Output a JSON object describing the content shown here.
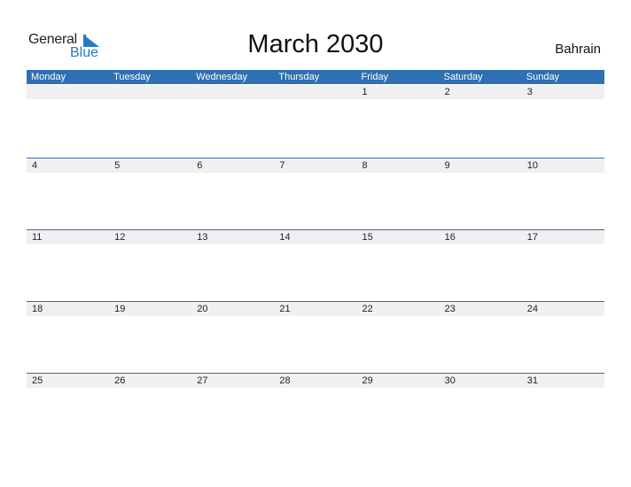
{
  "logo": {
    "general": "General",
    "blue": "Blue"
  },
  "title": "March 2030",
  "country": "Bahrain",
  "weekdays": [
    "Monday",
    "Tuesday",
    "Wednesday",
    "Thursday",
    "Friday",
    "Saturday",
    "Sunday"
  ],
  "weeks": [
    [
      "",
      "",
      "",
      "",
      "1",
      "2",
      "3"
    ],
    [
      "4",
      "5",
      "6",
      "7",
      "8",
      "9",
      "10"
    ],
    [
      "11",
      "12",
      "13",
      "14",
      "15",
      "16",
      "17"
    ],
    [
      "18",
      "19",
      "20",
      "21",
      "22",
      "23",
      "24"
    ],
    [
      "25",
      "26",
      "27",
      "28",
      "29",
      "30",
      "31"
    ]
  ],
  "colors": {
    "accent": "#2e70b2",
    "brand_blue": "#2b78c6",
    "row_bg": "#f0f0f0"
  }
}
